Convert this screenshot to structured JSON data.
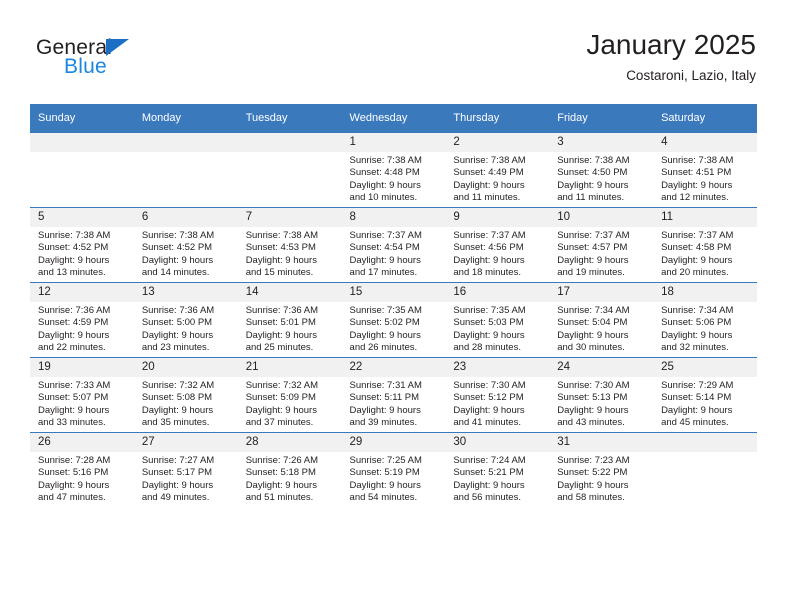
{
  "brand": {
    "name_top": "General",
    "name_bottom": "Blue",
    "triangle_color": "#1b6fc4",
    "blue_text_color": "#1b86e2"
  },
  "header": {
    "month_title": "January 2025",
    "location": "Costaroni, Lazio, Italy"
  },
  "theme": {
    "header_blue": "#3b79bd",
    "daynum_band": "#f1f1f1",
    "text": "#231f20"
  },
  "weekday_headers": [
    "Sunday",
    "Monday",
    "Tuesday",
    "Wednesday",
    "Thursday",
    "Friday",
    "Saturday"
  ],
  "labels": {
    "sunrise_prefix": "Sunrise:",
    "sunset_prefix": "Sunset:",
    "daylight_prefix": "Daylight:"
  },
  "weeks": [
    [
      {
        "day": "",
        "empty": true,
        "line1": "",
        "line2": "",
        "line3": "",
        "line4": ""
      },
      {
        "day": "",
        "empty": true,
        "line1": "",
        "line2": "",
        "line3": "",
        "line4": ""
      },
      {
        "day": "",
        "empty": true,
        "line1": "",
        "line2": "",
        "line3": "",
        "line4": ""
      },
      {
        "day": "1",
        "empty": false,
        "line1": "Sunrise: 7:38 AM",
        "line2": "Sunset: 4:48 PM",
        "line3": "Daylight: 9 hours",
        "line4": "and 10 minutes."
      },
      {
        "day": "2",
        "empty": false,
        "line1": "Sunrise: 7:38 AM",
        "line2": "Sunset: 4:49 PM",
        "line3": "Daylight: 9 hours",
        "line4": "and 11 minutes."
      },
      {
        "day": "3",
        "empty": false,
        "line1": "Sunrise: 7:38 AM",
        "line2": "Sunset: 4:50 PM",
        "line3": "Daylight: 9 hours",
        "line4": "and 11 minutes."
      },
      {
        "day": "4",
        "empty": false,
        "line1": "Sunrise: 7:38 AM",
        "line2": "Sunset: 4:51 PM",
        "line3": "Daylight: 9 hours",
        "line4": "and 12 minutes."
      }
    ],
    [
      {
        "day": "5",
        "empty": false,
        "line1": "Sunrise: 7:38 AM",
        "line2": "Sunset: 4:52 PM",
        "line3": "Daylight: 9 hours",
        "line4": "and 13 minutes."
      },
      {
        "day": "6",
        "empty": false,
        "line1": "Sunrise: 7:38 AM",
        "line2": "Sunset: 4:52 PM",
        "line3": "Daylight: 9 hours",
        "line4": "and 14 minutes."
      },
      {
        "day": "7",
        "empty": false,
        "line1": "Sunrise: 7:38 AM",
        "line2": "Sunset: 4:53 PM",
        "line3": "Daylight: 9 hours",
        "line4": "and 15 minutes."
      },
      {
        "day": "8",
        "empty": false,
        "line1": "Sunrise: 7:37 AM",
        "line2": "Sunset: 4:54 PM",
        "line3": "Daylight: 9 hours",
        "line4": "and 17 minutes."
      },
      {
        "day": "9",
        "empty": false,
        "line1": "Sunrise: 7:37 AM",
        "line2": "Sunset: 4:56 PM",
        "line3": "Daylight: 9 hours",
        "line4": "and 18 minutes."
      },
      {
        "day": "10",
        "empty": false,
        "line1": "Sunrise: 7:37 AM",
        "line2": "Sunset: 4:57 PM",
        "line3": "Daylight: 9 hours",
        "line4": "and 19 minutes."
      },
      {
        "day": "11",
        "empty": false,
        "line1": "Sunrise: 7:37 AM",
        "line2": "Sunset: 4:58 PM",
        "line3": "Daylight: 9 hours",
        "line4": "and 20 minutes."
      }
    ],
    [
      {
        "day": "12",
        "empty": false,
        "line1": "Sunrise: 7:36 AM",
        "line2": "Sunset: 4:59 PM",
        "line3": "Daylight: 9 hours",
        "line4": "and 22 minutes."
      },
      {
        "day": "13",
        "empty": false,
        "line1": "Sunrise: 7:36 AM",
        "line2": "Sunset: 5:00 PM",
        "line3": "Daylight: 9 hours",
        "line4": "and 23 minutes."
      },
      {
        "day": "14",
        "empty": false,
        "line1": "Sunrise: 7:36 AM",
        "line2": "Sunset: 5:01 PM",
        "line3": "Daylight: 9 hours",
        "line4": "and 25 minutes."
      },
      {
        "day": "15",
        "empty": false,
        "line1": "Sunrise: 7:35 AM",
        "line2": "Sunset: 5:02 PM",
        "line3": "Daylight: 9 hours",
        "line4": "and 26 minutes."
      },
      {
        "day": "16",
        "empty": false,
        "line1": "Sunrise: 7:35 AM",
        "line2": "Sunset: 5:03 PM",
        "line3": "Daylight: 9 hours",
        "line4": "and 28 minutes."
      },
      {
        "day": "17",
        "empty": false,
        "line1": "Sunrise: 7:34 AM",
        "line2": "Sunset: 5:04 PM",
        "line3": "Daylight: 9 hours",
        "line4": "and 30 minutes."
      },
      {
        "day": "18",
        "empty": false,
        "line1": "Sunrise: 7:34 AM",
        "line2": "Sunset: 5:06 PM",
        "line3": "Daylight: 9 hours",
        "line4": "and 32 minutes."
      }
    ],
    [
      {
        "day": "19",
        "empty": false,
        "line1": "Sunrise: 7:33 AM",
        "line2": "Sunset: 5:07 PM",
        "line3": "Daylight: 9 hours",
        "line4": "and 33 minutes."
      },
      {
        "day": "20",
        "empty": false,
        "line1": "Sunrise: 7:32 AM",
        "line2": "Sunset: 5:08 PM",
        "line3": "Daylight: 9 hours",
        "line4": "and 35 minutes."
      },
      {
        "day": "21",
        "empty": false,
        "line1": "Sunrise: 7:32 AM",
        "line2": "Sunset: 5:09 PM",
        "line3": "Daylight: 9 hours",
        "line4": "and 37 minutes."
      },
      {
        "day": "22",
        "empty": false,
        "line1": "Sunrise: 7:31 AM",
        "line2": "Sunset: 5:11 PM",
        "line3": "Daylight: 9 hours",
        "line4": "and 39 minutes."
      },
      {
        "day": "23",
        "empty": false,
        "line1": "Sunrise: 7:30 AM",
        "line2": "Sunset: 5:12 PM",
        "line3": "Daylight: 9 hours",
        "line4": "and 41 minutes."
      },
      {
        "day": "24",
        "empty": false,
        "line1": "Sunrise: 7:30 AM",
        "line2": "Sunset: 5:13 PM",
        "line3": "Daylight: 9 hours",
        "line4": "and 43 minutes."
      },
      {
        "day": "25",
        "empty": false,
        "line1": "Sunrise: 7:29 AM",
        "line2": "Sunset: 5:14 PM",
        "line3": "Daylight: 9 hours",
        "line4": "and 45 minutes."
      }
    ],
    [
      {
        "day": "26",
        "empty": false,
        "line1": "Sunrise: 7:28 AM",
        "line2": "Sunset: 5:16 PM",
        "line3": "Daylight: 9 hours",
        "line4": "and 47 minutes."
      },
      {
        "day": "27",
        "empty": false,
        "line1": "Sunrise: 7:27 AM",
        "line2": "Sunset: 5:17 PM",
        "line3": "Daylight: 9 hours",
        "line4": "and 49 minutes."
      },
      {
        "day": "28",
        "empty": false,
        "line1": "Sunrise: 7:26 AM",
        "line2": "Sunset: 5:18 PM",
        "line3": "Daylight: 9 hours",
        "line4": "and 51 minutes."
      },
      {
        "day": "29",
        "empty": false,
        "line1": "Sunrise: 7:25 AM",
        "line2": "Sunset: 5:19 PM",
        "line3": "Daylight: 9 hours",
        "line4": "and 54 minutes."
      },
      {
        "day": "30",
        "empty": false,
        "line1": "Sunrise: 7:24 AM",
        "line2": "Sunset: 5:21 PM",
        "line3": "Daylight: 9 hours",
        "line4": "and 56 minutes."
      },
      {
        "day": "31",
        "empty": false,
        "line1": "Sunrise: 7:23 AM",
        "line2": "Sunset: 5:22 PM",
        "line3": "Daylight: 9 hours",
        "line4": "and 58 minutes."
      },
      {
        "day": "",
        "empty": true,
        "line1": "",
        "line2": "",
        "line3": "",
        "line4": ""
      }
    ]
  ]
}
